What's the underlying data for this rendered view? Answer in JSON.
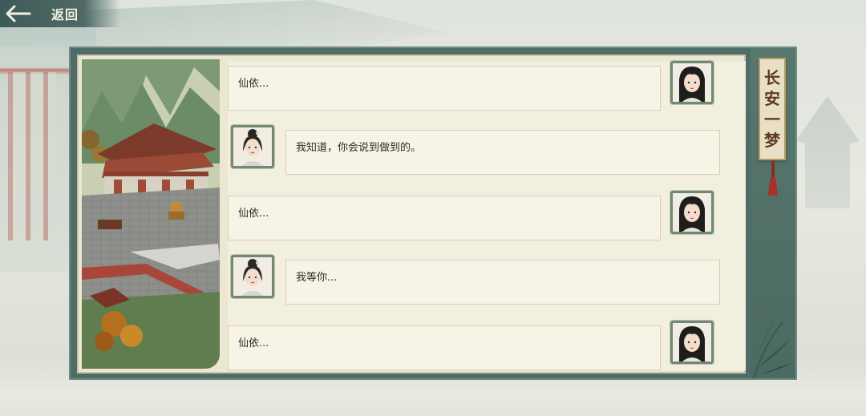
{
  "header": {
    "back_label": "返回"
  },
  "banner": {
    "chars": [
      "长",
      "安",
      "一",
      "梦"
    ]
  },
  "dialog": [
    {
      "speaker": "self",
      "text": "仙依..."
    },
    {
      "speaker": "npc",
      "text": "我知道，你会说到做到的。"
    },
    {
      "speaker": "self",
      "text": "仙依..."
    },
    {
      "speaker": "npc",
      "text": "我等你..."
    },
    {
      "speaker": "self",
      "text": "仙依..."
    }
  ],
  "colors": {
    "panel_frame": "#4e6d66",
    "paper": "#f3efde",
    "accent_red": "#a8322a"
  }
}
